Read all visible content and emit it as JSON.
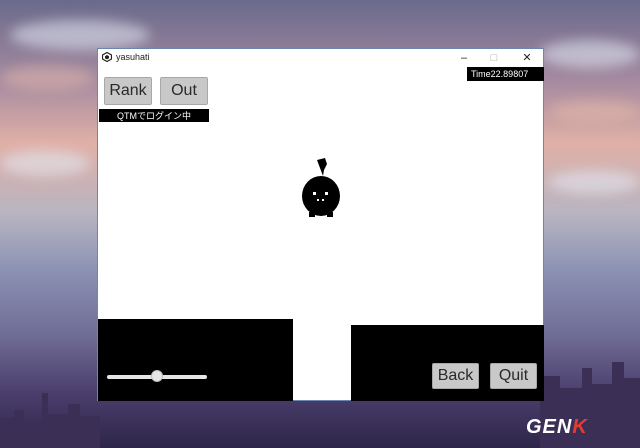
{
  "window": {
    "title": "yasuhati",
    "minimize_glyph": "–",
    "maximize_glyph": "□",
    "close_glyph": "✕"
  },
  "hud": {
    "rank_label": "Rank",
    "out_label": "Out",
    "timer_text": "Time22.89807",
    "status_text": "QTMでログイン中",
    "back_label": "Back",
    "quit_label": "Quit",
    "volume_level": 0.5
  },
  "icons": {
    "app": "unity-icon",
    "character": "black-bird-sprite"
  },
  "watermark": {
    "text_main": "GEN",
    "text_accent": "K",
    "accent_color": "#e43b32"
  }
}
